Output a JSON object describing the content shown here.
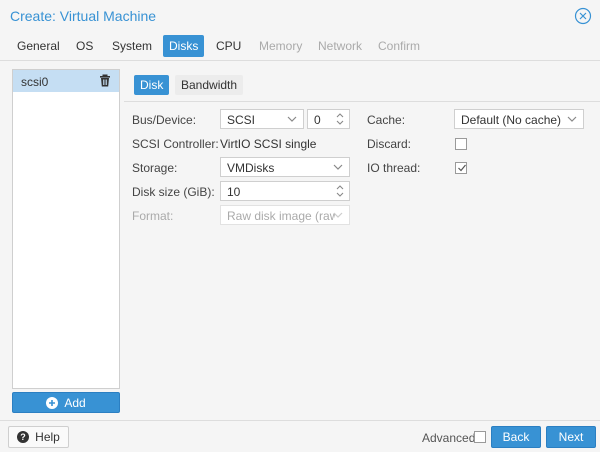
{
  "window": {
    "title": "Create: Virtual Machine",
    "close_icon": "close-circle-icon"
  },
  "tabs": [
    {
      "label": "General",
      "state": "normal"
    },
    {
      "label": "OS",
      "state": "normal"
    },
    {
      "label": "System",
      "state": "normal"
    },
    {
      "label": "Disks",
      "state": "active"
    },
    {
      "label": "CPU",
      "state": "normal"
    },
    {
      "label": "Memory",
      "state": "disabled"
    },
    {
      "label": "Network",
      "state": "disabled"
    },
    {
      "label": "Confirm",
      "state": "disabled"
    }
  ],
  "disks": {
    "items": [
      {
        "label": "scsi0",
        "icon": "trash-icon"
      }
    ],
    "add_label": "Add",
    "add_icon": "plus-circle-icon"
  },
  "subtabs": [
    {
      "label": "Disk",
      "state": "active"
    },
    {
      "label": "Bandwidth",
      "state": "inactive"
    }
  ],
  "form": {
    "bus_device_label": "Bus/Device:",
    "bus_value": "SCSI",
    "device_value": "0",
    "scsi_controller_label": "SCSI Controller:",
    "scsi_controller_value": "VirtIO SCSI single",
    "storage_label": "Storage:",
    "storage_value": "VMDisks",
    "disk_size_label": "Disk size (GiB):",
    "disk_size_value": "10",
    "format_label": "Format:",
    "format_value": "Raw disk image (raw",
    "cache_label": "Cache:",
    "cache_value": "Default (No cache)",
    "discard_label": "Discard:",
    "discard_checked": false,
    "io_thread_label": "IO thread:",
    "io_thread_checked": true
  },
  "footer": {
    "help_label": "Help",
    "help_icon": "question-circle-icon",
    "advanced_label": "Advanced",
    "advanced_checked": false,
    "back_label": "Back",
    "next_label": "Next"
  },
  "colors": {
    "accent": "#3892d4",
    "selected_row": "#c5def3",
    "disabled_text": "#aaaaaa"
  }
}
